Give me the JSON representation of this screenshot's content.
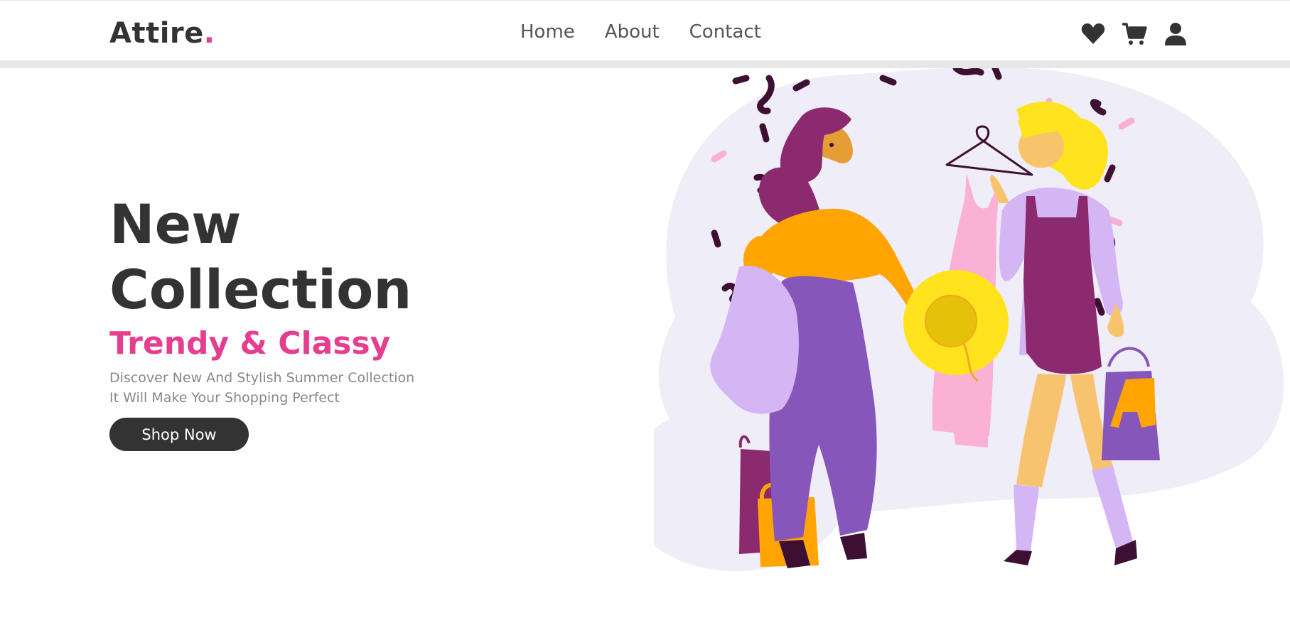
{
  "brand": {
    "name": "Attire",
    "dot": "."
  },
  "nav": {
    "links": [
      {
        "label": "Home"
      },
      {
        "label": "About"
      },
      {
        "label": "Contact"
      }
    ],
    "icons": [
      "heart-icon",
      "cart-icon",
      "user-icon"
    ]
  },
  "hero": {
    "title_line1": "New",
    "title_line2": "Collection",
    "subtitle": "Trendy & Classy",
    "desc_line1": "Discover New And Stylish Summer Collection",
    "desc_line2": "It Will Make Your Shopping Perfect",
    "button_label": "Shop Now"
  },
  "colors": {
    "text_dark": "#333333",
    "accent_pink": "#e63e8f",
    "muted": "#888888",
    "illustration_bg": "#efedf7"
  }
}
